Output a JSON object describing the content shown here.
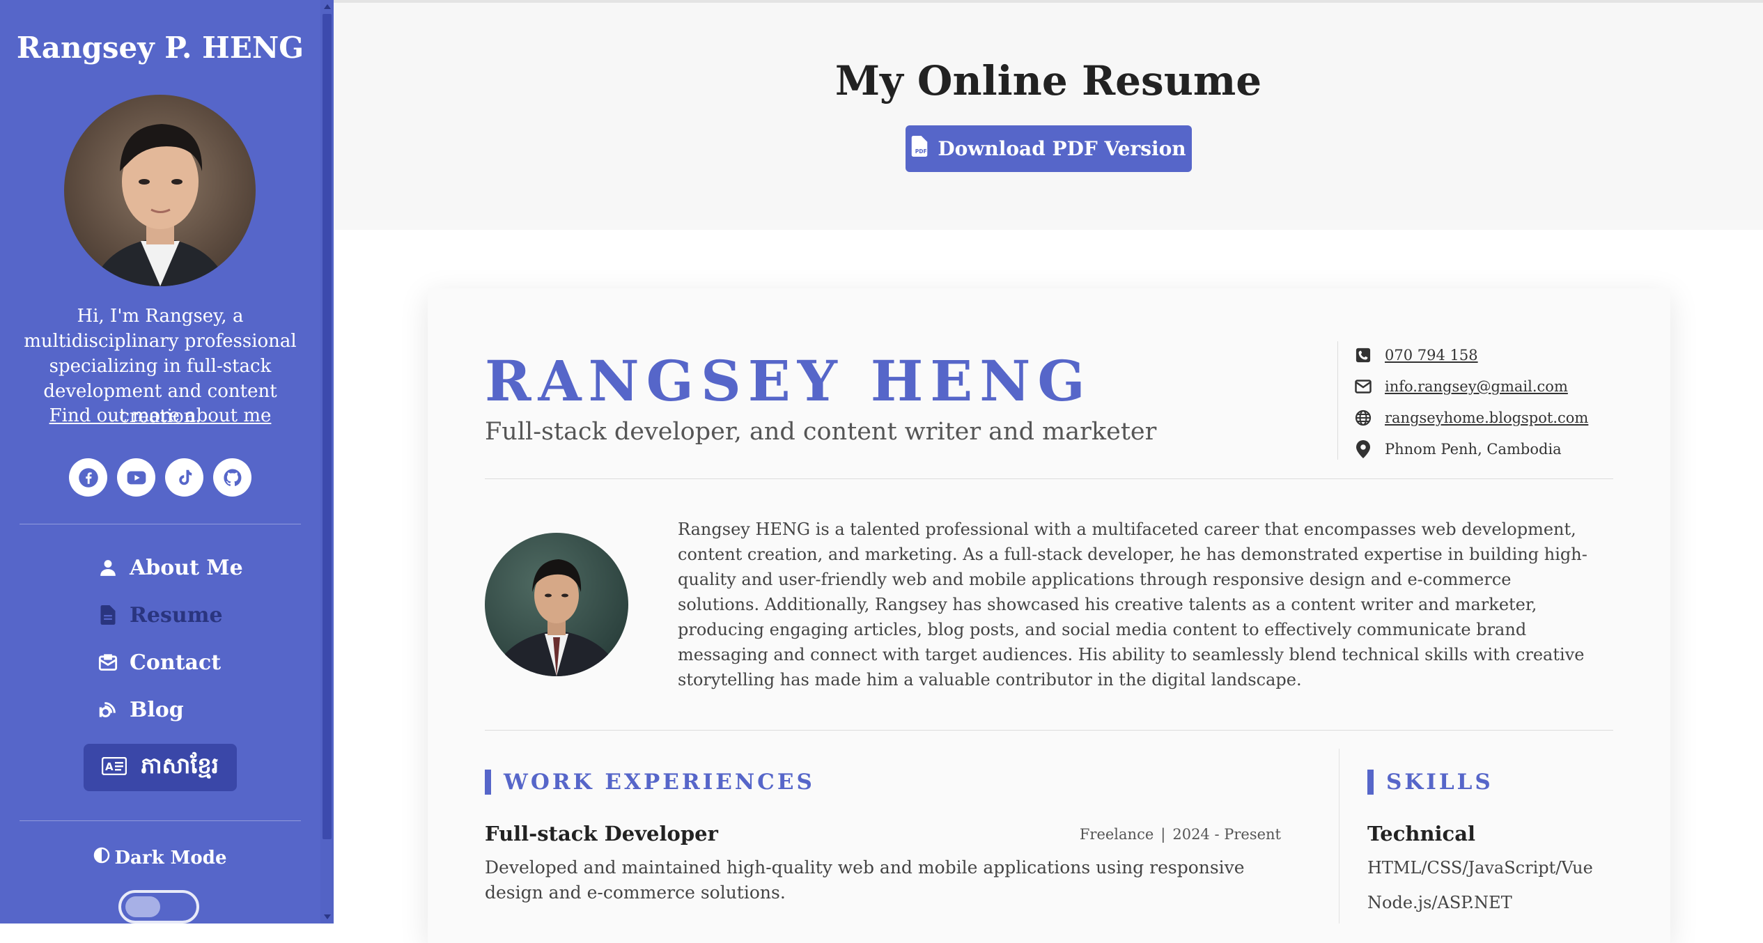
{
  "sidebar": {
    "name": "Rangsey P. HENG",
    "intro": "Hi, I'm Rangsey, a multidisciplinary professional specializing in full-stack development and content creation.",
    "more_link": "Find out more about me",
    "social": [
      {
        "icon": "facebook-icon"
      },
      {
        "icon": "youtube-icon"
      },
      {
        "icon": "tiktok-icon"
      },
      {
        "icon": "github-icon"
      }
    ],
    "nav": [
      {
        "label": "About Me",
        "icon": "user-icon"
      },
      {
        "label": "Resume",
        "icon": "document-icon",
        "active": true
      },
      {
        "label": "Contact",
        "icon": "envelope-icon"
      },
      {
        "label": "Blog",
        "icon": "blog-icon"
      }
    ],
    "language_button": "ភាសាខ្មែរ",
    "dark_mode_label": "Dark Mode",
    "dark_mode_on": false
  },
  "header": {
    "title": "My Online Resume",
    "download_label": "Download PDF Version"
  },
  "resume": {
    "name": "RANGSEY HENG",
    "title": "Full-stack developer, and content writer and marketer",
    "contact": {
      "phone": "070 794 158",
      "email": "info.rangsey@gmail.com",
      "website": "rangseyhome.blogspot.com",
      "location": "Phnom Penh, Cambodia"
    },
    "about": "Rangsey HENG is a talented professional with a multifaceted career that encompasses web development, content creation, and marketing. As a full-stack developer, he has demonstrated expertise in building high-quality and user-friendly web and mobile applications through responsive design and e-commerce solutions. Additionally, Rangsey has showcased his creative talents as a content writer and marketer, producing engaging articles, blog posts, and social media content to effectively communicate brand messaging and connect with target audiences. His ability to seamlessly blend technical skills with creative storytelling has made him a valuable contributor in the digital landscape.",
    "work_heading": "WORK EXPERIENCES",
    "job": {
      "title": "Full-stack Developer",
      "company": "Freelance",
      "separator": "|",
      "period": "2024 - Present",
      "description": "Developed and maintained high-quality web and mobile applications using responsive design and e-commerce solutions."
    },
    "skills_heading": "SKILLS",
    "skills_sub": "Technical",
    "skills": [
      "HTML/CSS/JavaScript/Vue",
      "Node.js/ASP.NET"
    ]
  },
  "colors": {
    "accent": "#5666c9",
    "sidebar_active": "#2a357f",
    "language_button_bg": "#3a47a8"
  }
}
